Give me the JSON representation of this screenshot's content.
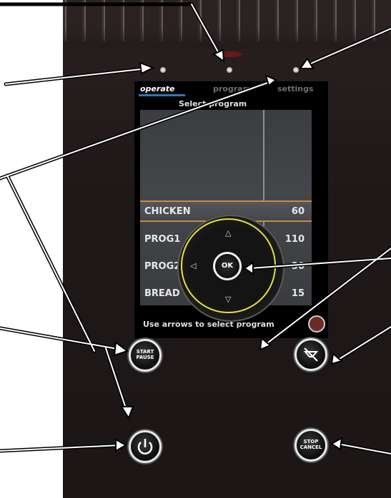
{
  "tabs": {
    "operate": "operate",
    "program": "program",
    "settings": "settings"
  },
  "screen_title": "Select program",
  "programs": [
    {
      "name": "CHICKEN",
      "value": "60"
    },
    {
      "name": "PROG1",
      "value": "110"
    },
    {
      "name": "PROG2",
      "value": "30"
    },
    {
      "name": "BREAD",
      "value": "15"
    }
  ],
  "hint": "Use arrows to select program",
  "buttons": {
    "start_pause": "START PAUSE",
    "stop_cancel": "STOP CANCEL",
    "ok": "OK"
  },
  "colors": {
    "panel": "#1f1818",
    "ring": "#e6e23a",
    "selected_border": "#c98a4a",
    "tab_accent": "#2a78b9"
  }
}
